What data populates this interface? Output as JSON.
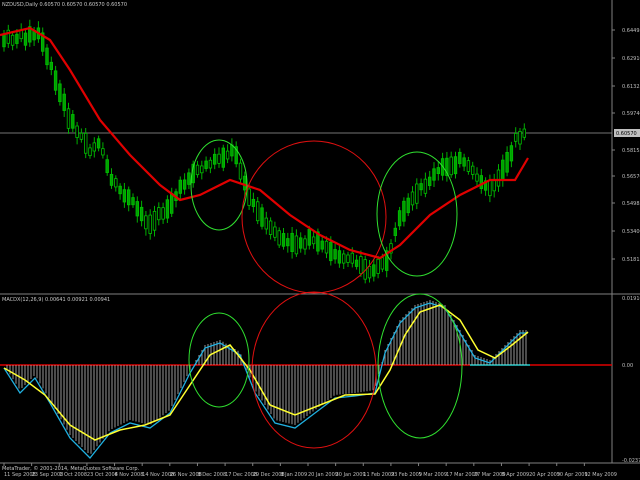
{
  "window": {
    "main_header": "NZDUSD,Daily  0.60570 0.60570 0.60570 0.60570",
    "sub_header": "MACDX(12,26,9) 0.00641 0.00921 0.00941",
    "copyright": "MetaTrader, © 2001-2014, MetaQuotes Software Corp."
  },
  "price_axis": [
    "0.64495",
    "0.62910",
    "0.61325",
    "0.59740",
    "0.58155",
    "0.56570",
    "0.54985",
    "0.53400",
    "0.51815"
  ],
  "current_price": "0.60570",
  "macd_axis": [
    "0.01910",
    "0.00",
    "-0.02377"
  ],
  "time_axis": [
    "11 Sep 2008",
    "23 Sep 2008",
    "1 Oct 2008",
    "23 Oct 2008",
    "4 Nov 2008",
    "14 Nov 2008",
    "26 Nov 2008",
    "8 Dec 2008",
    "17 Dec 2008",
    "29 Dec 2008",
    "8 Jan 2009",
    "20 Jan 2009",
    "30 Jan 2009",
    "11 Feb 2009",
    "23 Feb 2009",
    "5 Mar 2009",
    "17 Mar 2009",
    "27 Mar 2009",
    "8 Apr 2009",
    "20 Apr 2009",
    "30 Apr 2009",
    "12 May 2009"
  ],
  "colors": {
    "bull": "#00c000",
    "bear": "#00a000",
    "ma": "#e00000",
    "signal": "#ffff30",
    "macd": "#20b0e0",
    "circle_green": "#30e030",
    "circle_red": "#e01010",
    "zero": "#e00000",
    "zero_cyan": "#00d0d0"
  }
}
